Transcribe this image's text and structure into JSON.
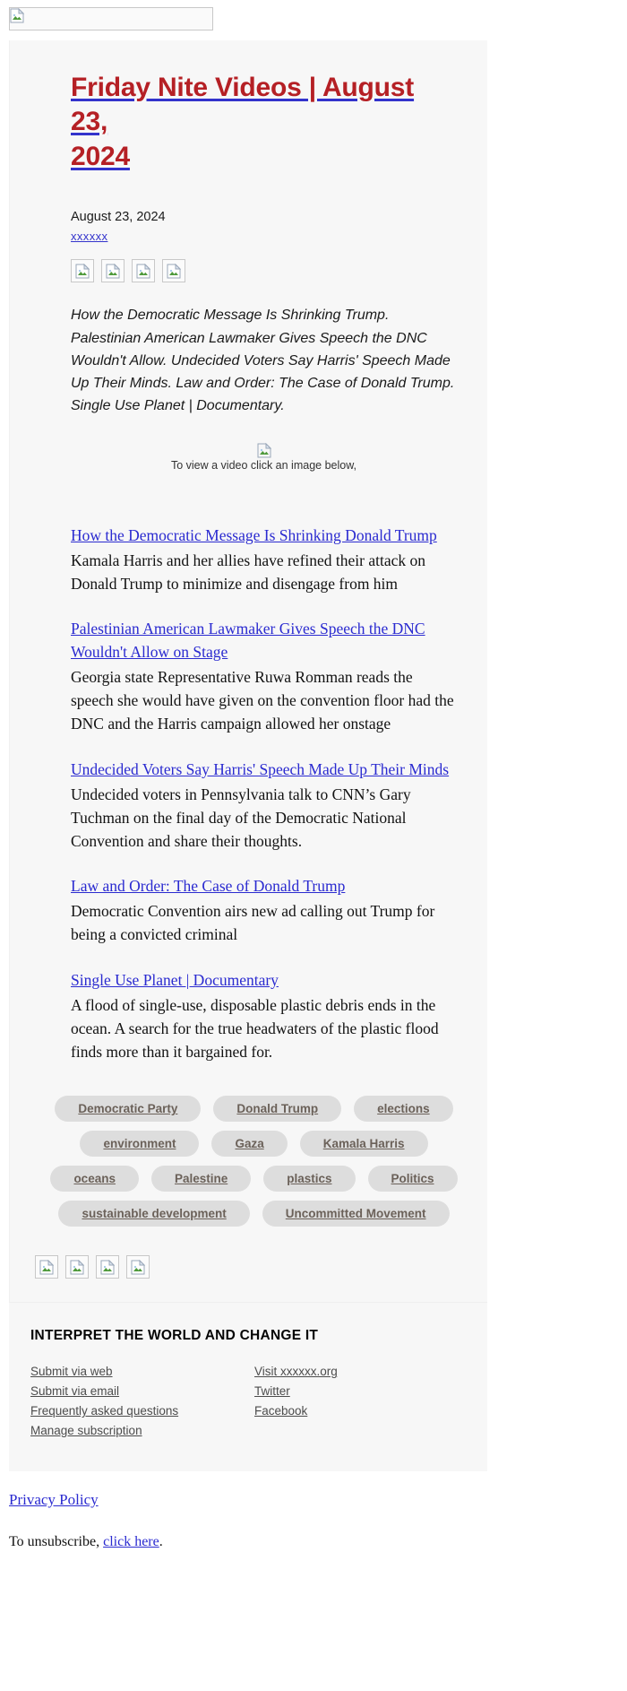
{
  "header": {
    "logo_alt_icon": "broken-image-icon"
  },
  "title": {
    "line1": "Friday Nite Videos | August 23,",
    "line2": "2024"
  },
  "meta": {
    "date": "August 23, 2024",
    "site": "xxxxxx"
  },
  "top_icons": [
    {
      "name": "social-icon-1"
    },
    {
      "name": "social-icon-2"
    },
    {
      "name": "social-icon-3"
    },
    {
      "name": "social-icon-4"
    }
  ],
  "summary": "How the Democratic Message Is Shrinking Trump. Palestinian American Lawmaker Gives Speech the DNC Wouldn't Allow. Undecided Voters Say Harris' Speech Made Up Their Minds. Law and Order: The Case of Donald Trump. Single Use Planet | Documentary.",
  "view_note": "To view a video click an image below,",
  "articles": [
    {
      "headline": "How the Democratic Message Is Shrinking Donald Trump",
      "blurb": "Kamala Harris and her allies have refined their attack on Donald Trump to minimize and disengage from him"
    },
    {
      "headline": "Palestinian American Lawmaker Gives Speech the DNC Wouldn't Allow on Stage",
      "blurb": "Georgia state Representative Ruwa Romman reads the speech she would have given on the convention floor had the DNC and the Harris campaign allowed her onstage"
    },
    {
      "headline": "Undecided Voters Say Harris' Speech Made Up Their Minds",
      "blurb": "Undecided voters in Pennsylvania talk to CNN’s Gary Tuchman on the final day of the Democratic National Convention and share their thoughts."
    },
    {
      "headline": "Law and Order: The Case of Donald Trump",
      "blurb": "Democratic Convention airs new ad calling out Trump for being a convicted criminal"
    },
    {
      "headline": "Single Use Planet | Documentary",
      "blurb": "A flood of single-use, disposable plastic debris ends in the ocean. A search for the true headwaters of the plastic flood finds more than it bargained for."
    }
  ],
  "tags": [
    "Democratic Party",
    "Donald Trump",
    "elections",
    "environment",
    "Gaza",
    "Kamala Harris",
    "oceans",
    "Palestine",
    "plastics",
    "Politics",
    "sustainable development",
    "Uncommitted Movement"
  ],
  "bottom_icons": [
    {
      "name": "social-icon-1"
    },
    {
      "name": "social-icon-2"
    },
    {
      "name": "social-icon-3"
    },
    {
      "name": "social-icon-4"
    }
  ],
  "footer": {
    "heading": "INTERPRET THE WORLD AND CHANGE IT",
    "left_links": [
      "Submit via web",
      "Submit via email",
      "Frequently asked questions",
      "Manage subscription"
    ],
    "right_links": [
      "Visit xxxxxx.org",
      "Twitter",
      "Facebook"
    ]
  },
  "tail": {
    "privacy": "Privacy Policy",
    "unsub_prefix": "To unsubscribe, ",
    "unsub_link": "click here",
    "unsub_suffix": "."
  },
  "colors": {
    "title_red": "#b52025",
    "link_blue": "#2a2ad0",
    "tag_bg": "#dddddd",
    "tag_text": "#6b6159",
    "panel_bg": "#f7f7f7"
  }
}
